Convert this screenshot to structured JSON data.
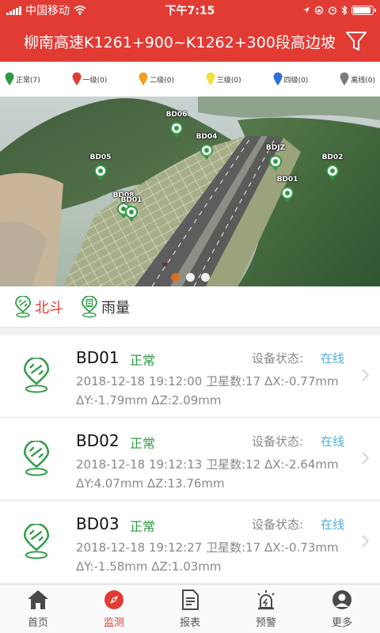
{
  "status_bar": {
    "carrier": "中国移动",
    "time": "下午7:15"
  },
  "header": {
    "title": "柳南高速K1261+900~K1262+300段高边坡"
  },
  "legend": [
    {
      "label": "正常(7)",
      "color": "#2e9b43"
    },
    {
      "label": "一级(0)",
      "color": "#e23b34"
    },
    {
      "label": "二级(0)",
      "color": "#f0a020"
    },
    {
      "label": "三级(0)",
      "color": "#f3e03a"
    },
    {
      "label": "四级(0)",
      "color": "#2f6fd8"
    },
    {
      "label": "离线(0)",
      "color": "#7a7a7a"
    }
  ],
  "map": {
    "markers": [
      "BD06",
      "BD04",
      "BD05",
      "BDJZ",
      "BD02",
      "BD01",
      "BD08",
      "BD01"
    ],
    "page_count": 3,
    "active_page": 1
  },
  "switch_tabs": [
    {
      "label": "北斗",
      "active": true
    },
    {
      "label": "雨量",
      "active": false
    }
  ],
  "device_status_label": "设备状态:",
  "devices": [
    {
      "name": "BD01",
      "status": "正常",
      "state": "在线",
      "detail": "2018-12-18 19:12:00 卫星数:17 ΔX:-0.77mm ΔY:-1.79mm ΔZ:2.09mm"
    },
    {
      "name": "BD02",
      "status": "正常",
      "state": "在线",
      "detail": "2018-12-18 19:12:13 卫星数:12 ΔX:-2.64mm ΔY:4.07mm ΔZ:13.76mm"
    },
    {
      "name": "BD03",
      "status": "正常",
      "state": "在线",
      "detail": "2018-12-18 19:12:27 卫星数:17 ΔX:-0.73mm ΔY:-1.58mm ΔZ:1.03mm"
    }
  ],
  "tabbar": [
    {
      "label": "首页",
      "icon": "home-icon",
      "active": false
    },
    {
      "label": "监测",
      "icon": "compass-icon",
      "active": true
    },
    {
      "label": "报表",
      "icon": "report-icon",
      "active": false
    },
    {
      "label": "预警",
      "icon": "alarm-icon",
      "active": false
    },
    {
      "label": "更多",
      "icon": "user-icon",
      "active": false
    }
  ]
}
